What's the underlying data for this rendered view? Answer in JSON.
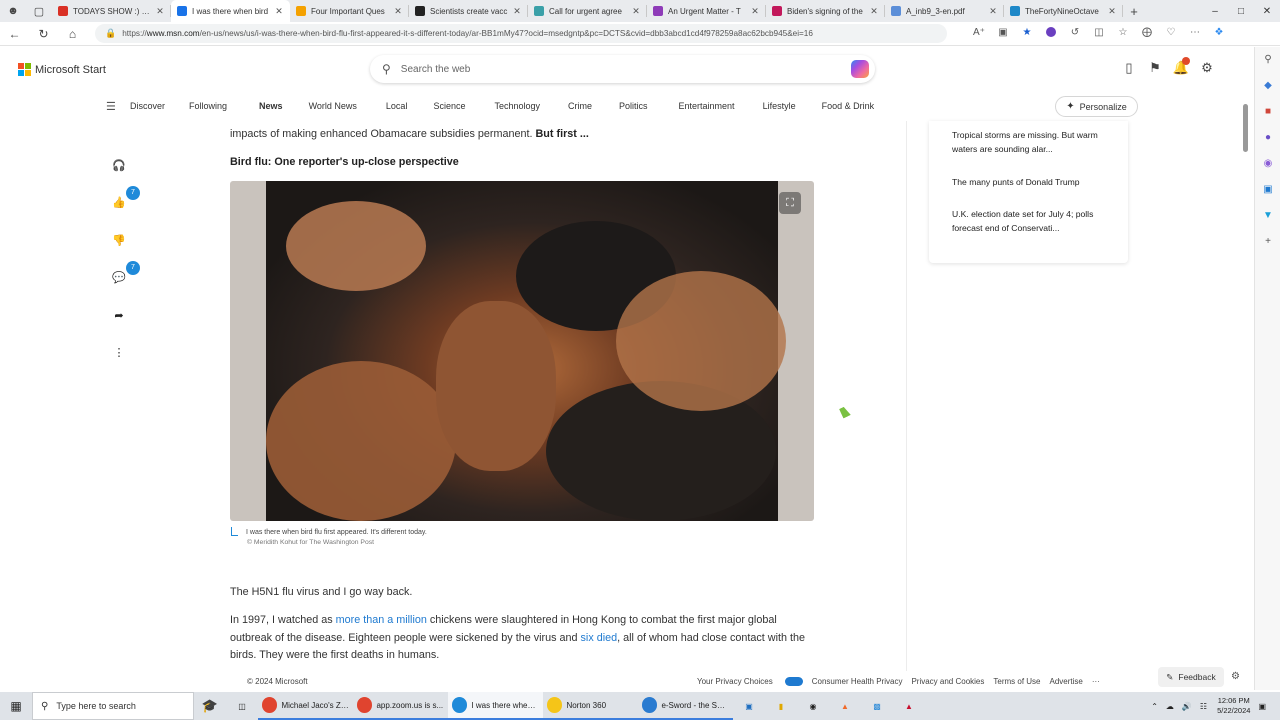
{
  "browser": {
    "tabs": [
      {
        "title": "TODAYS SHOW :) ZO",
        "color": "#d93025"
      },
      {
        "title": "I was there when bird",
        "color": "#1a73e8",
        "active": true
      },
      {
        "title": "Four Important Ques",
        "color": "#f4a100"
      },
      {
        "title": "Scientists create vacc",
        "color": "#222222"
      },
      {
        "title": "Call for urgent agree",
        "color": "#3aa0a8"
      },
      {
        "title": "An Urgent Matter - T",
        "color": "#8e3bb8"
      },
      {
        "title": "Biden's signing of the",
        "color": "#c2185b"
      },
      {
        "title": "A_inb9_3-en.pdf",
        "color": "#5b8ed8"
      },
      {
        "title": "TheFortyNineOctave",
        "color": "#1e88c8"
      }
    ],
    "new_tab_label": "+",
    "url_prefix": "https://",
    "url_host": "www.msn.com",
    "url_path": "/en-us/news/us/i-was-there-when-bird-flu-first-appeared-it-s-different-today/ar-BB1mMy47?ocid=msedgntp&pc=DCTS&cvid=dbb3abcd1cd4f978259a8ac62bcb945&ei=16"
  },
  "msn": {
    "brand": "Microsoft Start",
    "search_placeholder": "Search the web",
    "nav": [
      "Discover",
      "Following",
      "News",
      "World News",
      "Local",
      "Science",
      "Technology",
      "Crime",
      "Politics",
      "Entertainment",
      "Lifestyle",
      "Food & Drink"
    ],
    "nav_active": "News",
    "personalize_label": "Personalize"
  },
  "rail": {
    "like_count": "7",
    "comment_count": "7"
  },
  "article": {
    "lead_text": "impacts of making enhanced Obamacare subsidies permanent. ",
    "lead_bold": "But first ...",
    "subhead": "Bird flu: One reporter's up-close perspective",
    "caption": "I was there when bird flu first appeared. It's different today.",
    "credit": "© Meridith Kohut for The Washington Post",
    "p1": "The H5N1 flu virus and I go way back.",
    "p2_a": "In 1997, I watched as ",
    "p2_link1": "more than a million",
    "p2_b": " chickens were slaughtered in Hong Kong to combat the first major global outbreak of the disease. Eighteen people were sickened by the virus and ",
    "p2_link2": "six died",
    "p2_c": ", all of whom had close contact with the birds. They were the first deaths in humans."
  },
  "sidebar": {
    "items": [
      "Tropical storms are missing. But warm waters are sounding alar...",
      "The many punts of Donald Trump",
      "U.K. election date set for July 4; polls forecast end of Conservati..."
    ]
  },
  "footer": {
    "copyright": "© 2024 Microsoft",
    "links": [
      "Your Privacy Choices",
      "Consumer Health Privacy",
      "Privacy and Cookies",
      "Terms of Use",
      "Advertise",
      "···"
    ],
    "feedback": "Feedback"
  },
  "taskbar": {
    "search_placeholder": "Type here to search",
    "apps": [
      {
        "label": "Michael Jaco's Zo...",
        "color": "#e0442f"
      },
      {
        "label": "app.zoom.us is s...",
        "color": "#e0442f"
      },
      {
        "label": "I was there when ...",
        "color": "#1f8ad9",
        "active": true
      },
      {
        "label": "Norton 360",
        "color": "#f5c518"
      },
      {
        "label": "e-Sword - the Sw...",
        "color": "#2a7bd0"
      }
    ],
    "time": "12:06 PM",
    "date": "5/22/2024"
  },
  "colors": {
    "accent": "#1f7ad0",
    "badge": "#1f8ad9",
    "ms_red": "#f25022",
    "ms_green": "#7fba00",
    "ms_blue": "#00a4ef",
    "ms_yellow": "#ffb900"
  }
}
